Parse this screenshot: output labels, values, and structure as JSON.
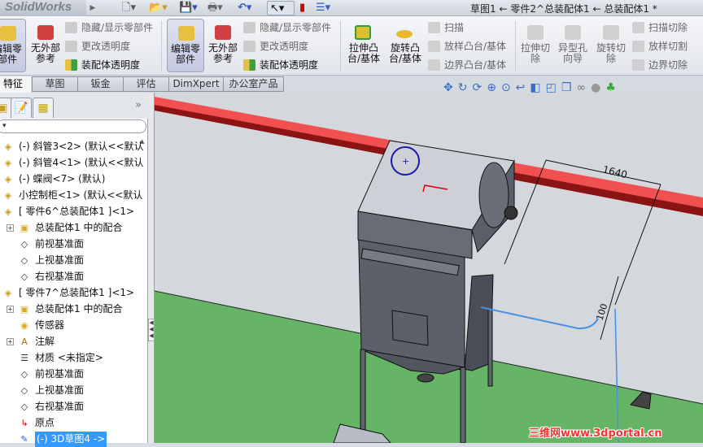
{
  "app": {
    "logo": "SolidWorks",
    "title": "草图1 ← 零件2^总装配体1 ← 总装配体1 *"
  },
  "quick_access": [
    {
      "icon": "new-document-icon",
      "glyph": "🗋"
    },
    {
      "icon": "open-folder-icon",
      "glyph": "📂"
    },
    {
      "icon": "save-icon",
      "glyph": "💾"
    },
    {
      "icon": "print-icon",
      "glyph": "🖶"
    },
    {
      "icon": "undo-icon",
      "glyph": "↶"
    },
    {
      "icon": "select-pointer-icon",
      "glyph": "↖"
    },
    {
      "icon": "rebuild-traffic-light-icon",
      "glyph": "▮"
    },
    {
      "icon": "options-list-icon",
      "glyph": "☰"
    }
  ],
  "ribbon": {
    "group1": {
      "edit_part": "编辑零部件",
      "no_external_refs": "无外部参考",
      "hide_show": "隐藏/显示零部件",
      "change_transparency": "更改透明度",
      "assembly_transparency": "装配体透明度"
    },
    "group2": {
      "edit_part": "编辑零部件",
      "no_external_refs": "无外部参考",
      "hide_show": "隐藏/显示零部件",
      "change_transparency": "更改透明度",
      "assembly_transparency": "装配体透明度"
    },
    "features": {
      "extrude_boss": "拉伸凸台/基体",
      "revolve_boss": "旋转凸台/基体",
      "sweep": "扫描",
      "loft_boss": "放样凸台/基体",
      "boundary_boss": "边界凸台/基体",
      "extrude_cut": "拉伸切除",
      "hole_wizard": "异型孔向导",
      "revolve_cut": "旋转切除",
      "sweep_cut": "扫描切除",
      "loft_cut": "放样切割",
      "boundary_cut": "边界切除"
    }
  },
  "tabs": [
    {
      "label": "特征",
      "active": true
    },
    {
      "label": "草图"
    },
    {
      "label": "钣金"
    },
    {
      "label": "评估"
    },
    {
      "label": "DimXpert"
    },
    {
      "label": "办公室产品"
    }
  ],
  "panel": {
    "collapse": "»",
    "filter": "▾"
  },
  "tree": [
    {
      "label": "(-) 斜管3<2> (默认<<默认",
      "icon": "part-icon"
    },
    {
      "label": "(-) 斜管4<1> (默认<<默认",
      "icon": "part-icon"
    },
    {
      "label": "(-) 蝶阀<7> (默认)",
      "icon": "part-icon"
    },
    {
      "label": "小控制柜<1> (默认<<默认",
      "icon": "part-icon"
    },
    {
      "label": "[ 零件6^总装配体1 ]<1>",
      "icon": "part-icon"
    },
    {
      "label": "总装配体1 中的配合",
      "icon": "mates-folder-icon"
    },
    {
      "label": "前视基准面",
      "icon": "plane-icon"
    },
    {
      "label": "上视基准面",
      "icon": "plane-icon"
    },
    {
      "label": "右视基准面",
      "icon": "plane-icon"
    },
    {
      "label": "[ 零件7^总装配体1 ]<1>",
      "icon": "part-icon"
    },
    {
      "label": "总装配体1 中的配合",
      "icon": "mates-folder-icon"
    },
    {
      "label": "传感器",
      "icon": "sensor-icon"
    },
    {
      "label": "注解",
      "icon": "annotation-icon"
    },
    {
      "label": "材质 <未指定>",
      "icon": "material-icon"
    },
    {
      "label": "前视基准面",
      "icon": "plane-icon"
    },
    {
      "label": "上视基准面",
      "icon": "plane-icon"
    },
    {
      "label": "右视基准面",
      "icon": "plane-icon"
    },
    {
      "label": "原点",
      "icon": "origin-icon"
    },
    {
      "label": "(-) 3D草图4 ->",
      "icon": "3d-sketch-icon",
      "selected": true
    }
  ],
  "viewport": {
    "dimension_1": "1640",
    "dimension_2": "100",
    "watermark": "三维网www.3dportal.cn",
    "colors": {
      "pipe": "#f05050",
      "floor": "#66b466",
      "wall": "#d4d7dc",
      "machine": "#5c606b",
      "sketch": "#4a90e2"
    }
  }
}
